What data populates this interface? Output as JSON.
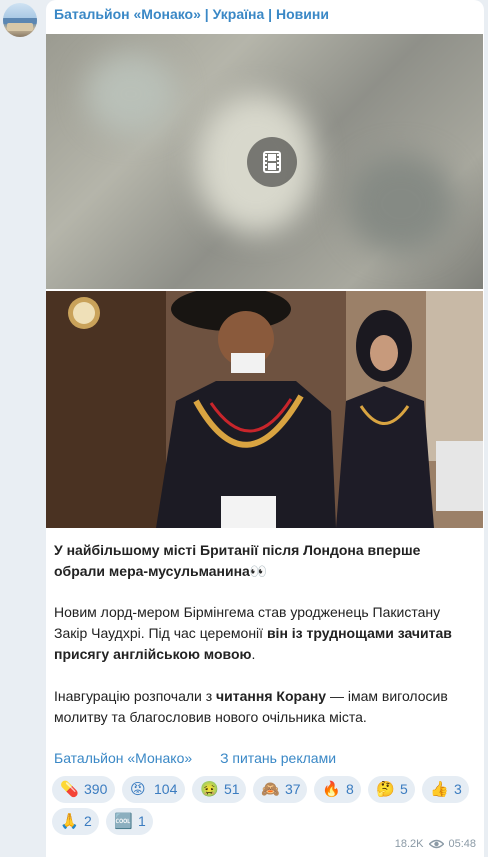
{
  "channel": {
    "name": "Батальйон «Монако» | Україна | Новини"
  },
  "media": {
    "video_icon": "film-icon",
    "photo_alt": "Лорд-мер Бірмінгема Закір Чаудхрі з дружиною"
  },
  "post": {
    "headline": "У найбільшому місті Британії після Лондона вперше обрали мера-мусульманина",
    "headline_emoji": "👀",
    "para1_a": "Новим лорд-мером Бірмінгема став уродженець Пакистану Закір Чаудхрі. Під час церемонії ",
    "para1_b": "він із труднощами зачитав присягу англійською мовою",
    "para1_c": ".",
    "para2_a": "Інавгурацію розпочали з ",
    "para2_b": "читання Корану",
    "para2_c": " — імам виголосив молитву та благословив нового очільника міста."
  },
  "links": {
    "channel": "Батальйон «Монако»",
    "ads": "З питань реклами"
  },
  "reactions": [
    {
      "emoji": "💊",
      "count": "390"
    },
    {
      "emoji": "😡",
      "count": "104"
    },
    {
      "emoji": "🤢",
      "count": "51"
    },
    {
      "emoji": "🙈",
      "count": "37"
    },
    {
      "emoji": "🔥",
      "count": "8"
    },
    {
      "emoji": "🤔",
      "count": "5"
    },
    {
      "emoji": "👍",
      "count": "3"
    },
    {
      "emoji": "🙏",
      "count": "2"
    },
    {
      "emoji": "🆒",
      "count": "1"
    }
  ],
  "meta": {
    "views": "18.2K",
    "time": "05:48",
    "views_icon": "eye-icon"
  },
  "colors": {
    "link": "#3a88c6",
    "reaction_bg": "#e6edf4",
    "bg": "#e9eef3"
  }
}
